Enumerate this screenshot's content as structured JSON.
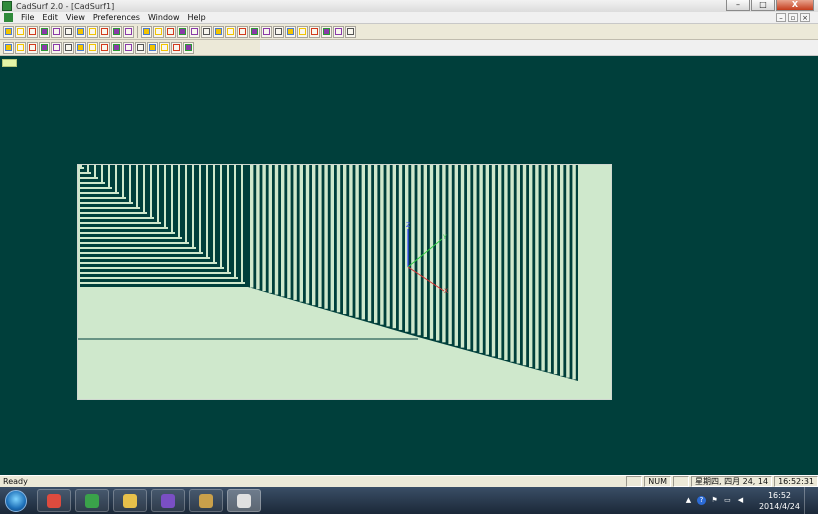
{
  "window": {
    "title": "CadSurf 2.0 - [CadSurf1]",
    "minimize_glyph": "–",
    "maximize_glyph": "□",
    "close_glyph": "X"
  },
  "menu": {
    "items": [
      "File",
      "Edit",
      "View",
      "Preferences",
      "Window",
      "Help"
    ],
    "mdi_minimize": "–",
    "mdi_restore": "▫",
    "mdi_close": "×"
  },
  "toolbar1": {
    "icons": [
      "new-file-icon",
      "open-folder-icon",
      "save-icon",
      "print-preview-icon",
      "print-icon",
      "help-pointer-icon",
      "point-icon",
      "point-on-curve-icon",
      "point-intersection-icon",
      "point-offset-icon",
      "line-icon",
      "divider",
      "curve-icon",
      "curve-grid-icon",
      "rectangle-filled-icon",
      "rectangle-icon",
      "triangle-icon",
      "circle-icon",
      "ellipse-icon",
      "parallelogram-icon",
      "rounded-rect-icon",
      "arc-icon",
      "spline-icon",
      "surface-icon",
      "surface-grid-icon",
      "mesh-icon",
      "grid-refine-icon",
      "node-edit-icon",
      "trim-icon",
      "warning-icon"
    ],
    "colors": {
      "accent_yellow": "#f2c400",
      "accent_red": "#d23a1c",
      "accent_green": "#2c9a33",
      "accent_purple": "#8a3aa8"
    }
  },
  "toolbar2": {
    "icons": [
      "layers-icon",
      "layer-new-icon",
      "layer-red-icon",
      "layer-stack-icon",
      "layer-copy-icon",
      "layer-delete-icon",
      "cube-icon",
      "pencil-icon",
      "crosshair-icon",
      "zoom-icon",
      "zoom-extents-icon",
      "pick-icon",
      "box-3d-icon",
      "wireframe-icon",
      "hatch-icon",
      "camera-icon"
    ]
  },
  "viewport": {
    "background_color": "#003f3b",
    "mesh_color": "#cfe8cc",
    "axes": {
      "z_label": "Z",
      "y_label": "Y",
      "x_label": "X",
      "z_color": "#3344ff",
      "y_color": "#33cc44",
      "x_color": "#dd3333"
    }
  },
  "status": {
    "text": "Ready",
    "num_indicator": "NUM",
    "date_text": "星期四, 四月 24, 14",
    "time_text": "16:52:31"
  },
  "taskbar": {
    "items": [
      {
        "name": "chrome-icon",
        "color": "#dd4b3e"
      },
      {
        "name": "app-green-icon",
        "color": "#3aa24a"
      },
      {
        "name": "explorer-folder-icon",
        "color": "#e7c04a"
      },
      {
        "name": "vs-infinity-icon",
        "color": "#7a4fc4"
      },
      {
        "name": "cad-pencil-icon",
        "color": "#c9a04a"
      },
      {
        "name": "cadsurf-icon",
        "color": "#e0e0e0"
      }
    ],
    "clock_time": "16:52",
    "clock_date": "2014/4/24"
  }
}
